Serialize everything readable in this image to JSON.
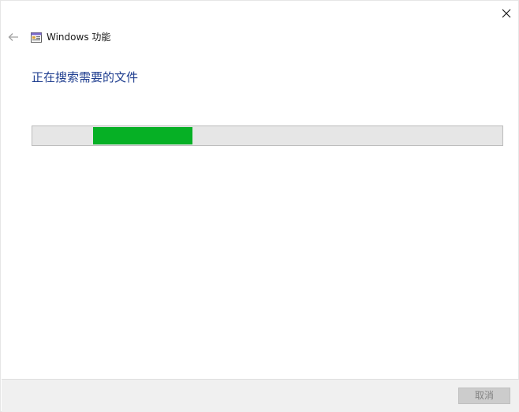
{
  "titlebar": {
    "title": "Windows 功能",
    "close_icon": "close-icon",
    "back_icon": "back-arrow-icon",
    "app_icon": "windows-features-icon"
  },
  "main": {
    "heading": "正在搜索需要的文件",
    "progress": {
      "kind": "indeterminate-marquee",
      "segment_start_fraction": 0.13,
      "segment_end_fraction": 0.34
    }
  },
  "footer": {
    "cancel_label": "取消",
    "cancel_enabled": false
  },
  "colors": {
    "accent_heading": "#1e3d8f",
    "progress_fill": "#06b025",
    "progress_track": "#e6e6e6"
  }
}
